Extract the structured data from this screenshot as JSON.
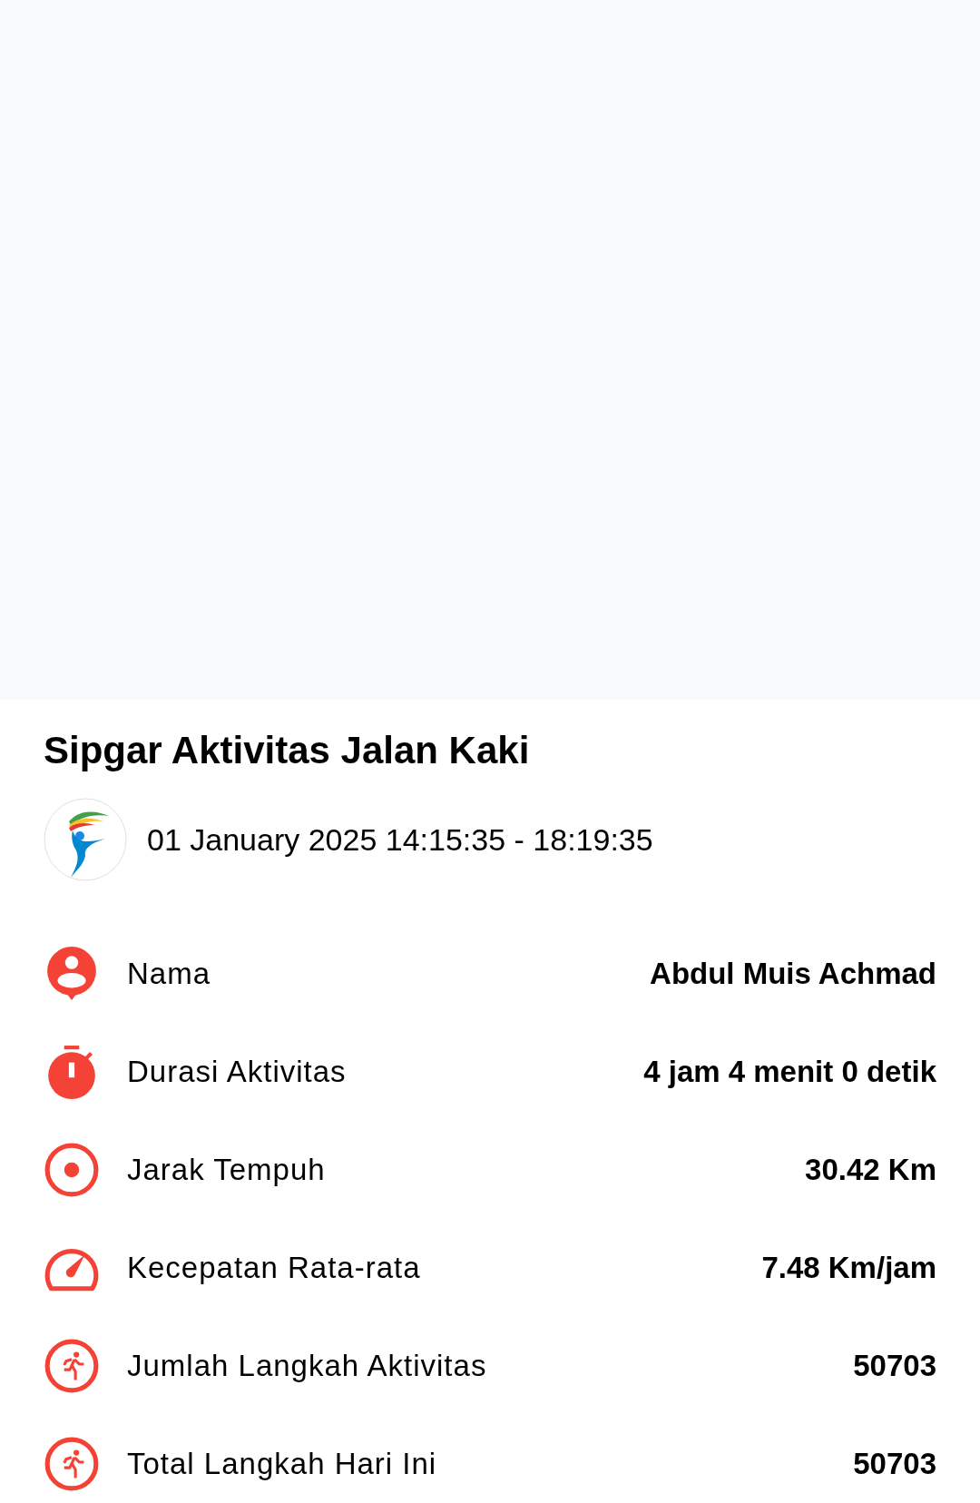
{
  "title": "Sipgar Aktivitas Jalan Kaki",
  "date_range": "01 January 2025 14:15:35 - 18:19:35",
  "stats": [
    {
      "kind": "person",
      "label": "Nama",
      "value": "Abdul Muis Achmad"
    },
    {
      "kind": "timer",
      "label": "Durasi Aktivitas",
      "value": "4 jam 4 menit 0 detik"
    },
    {
      "kind": "distance",
      "label": "Jarak Tempuh",
      "value": "30.42 Km"
    },
    {
      "kind": "speed",
      "label": "Kecepatan Rata-rata",
      "value": "7.48 Km/jam"
    },
    {
      "kind": "steps",
      "label": "Jumlah Langkah Aktivitas",
      "value": "50703"
    },
    {
      "kind": "steps",
      "label": "Total Langkah Hari Ini",
      "value": "50703"
    }
  ]
}
